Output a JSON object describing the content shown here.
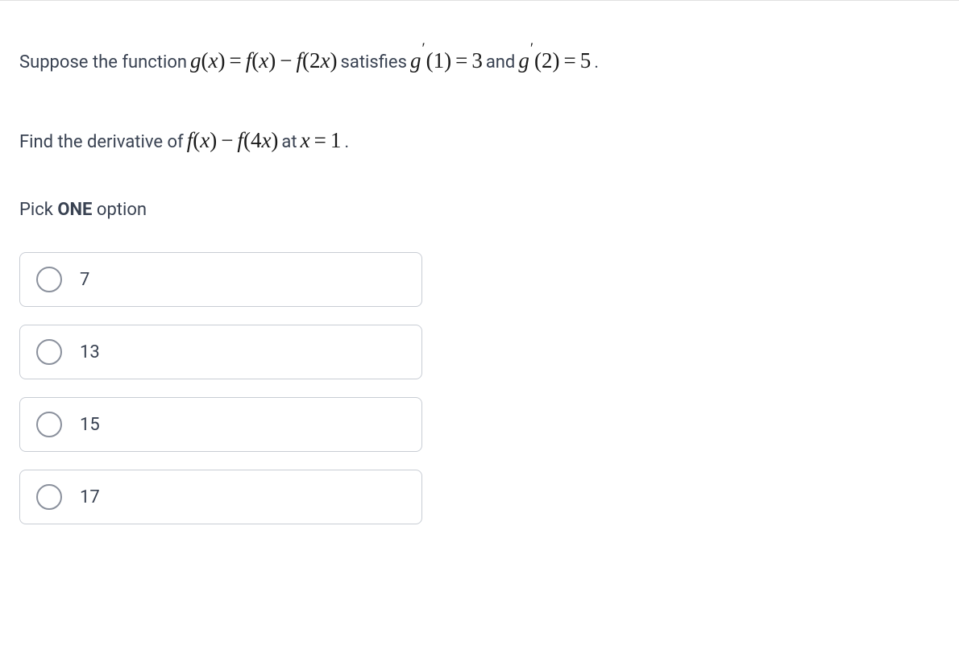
{
  "question": {
    "line1_prefix": "Suppose the function ",
    "line1_mid": " satisfies ",
    "line1_and": " and ",
    "line1_end": ".",
    "line2_prefix": "Find the derivative of ",
    "line2_mid": " at ",
    "line2_end": ".",
    "math_gx": "g(x) = f(x) − f(2x)",
    "math_gp1": "g′(1) = 3",
    "math_gp2": "g′(2) = 5",
    "math_fx4x": "f(x) − f(4x)",
    "math_x1": "x = 1"
  },
  "instruction": {
    "prefix": "Pick ",
    "bold": "ONE",
    "suffix": " option"
  },
  "options": [
    {
      "label": "7"
    },
    {
      "label": "13"
    },
    {
      "label": "15"
    },
    {
      "label": "17"
    }
  ]
}
